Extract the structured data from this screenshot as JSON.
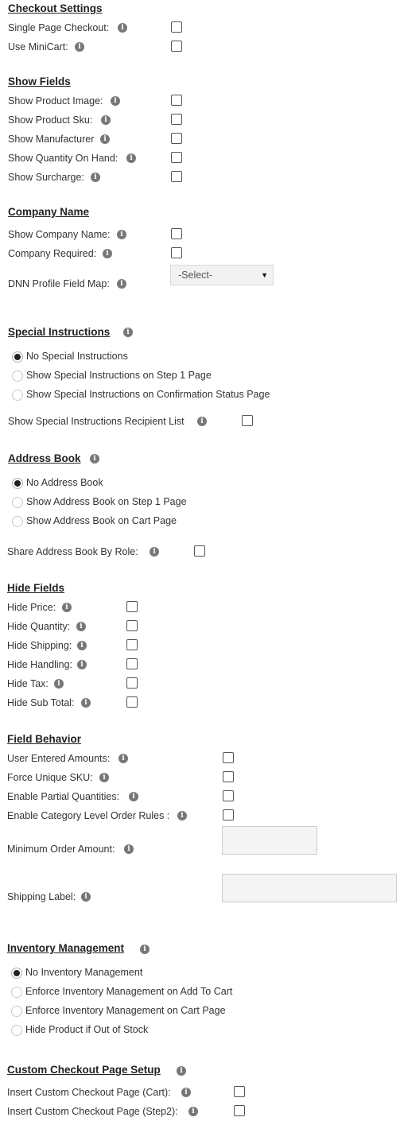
{
  "info_glyph": "i",
  "checkout": {
    "heading": "Checkout Settings",
    "single_page": "Single Page Checkout:",
    "use_minicart": "Use MiniCart:"
  },
  "show_fields": {
    "heading": "Show Fields",
    "product_image": "Show Product Image:",
    "product_sku": "Show Product Sku:",
    "manufacturer": "Show Manufacturer",
    "quantity_on_hand": "Show Quantity On Hand:",
    "surcharge": "Show Surcharge:"
  },
  "company": {
    "heading": "Company Name",
    "show_company": "Show Company Name:",
    "required": "Company Required:",
    "profile_map_label": "DNN Profile Field Map:",
    "profile_map_value": "-Select-"
  },
  "special_instructions": {
    "heading": "Special Instructions",
    "options": [
      "No Special Instructions",
      "Show Special Instructions on Step 1 Page",
      "Show Special Instructions on Confirmation Status Page"
    ],
    "selected_index": 0,
    "recipient_list": "Show Special Instructions Recipient List"
  },
  "address_book": {
    "heading": "Address Book",
    "options": [
      "No Address Book",
      "Show Address Book on Step 1 Page",
      "Show Address Book on Cart Page"
    ],
    "selected_index": 0,
    "share_by_role": "Share Address Book By Role:"
  },
  "hide_fields": {
    "heading": "Hide Fields",
    "price": "Hide Price:",
    "quantity": "Hide Quantity:",
    "shipping": "Hide Shipping:",
    "handling": "Hide Handling:",
    "tax": "Hide Tax:",
    "sub_total": "Hide Sub Total:"
  },
  "field_behavior": {
    "heading": "Field Behavior",
    "user_entered_amounts": "User Entered Amounts:",
    "force_unique_sku": "Force Unique SKU:",
    "partial_quantities": "Enable Partial Quantities:",
    "category_order_rules": "Enable Category Level Order Rules :",
    "minimum_order_amount": "Minimum Order Amount:",
    "minimum_order_value": "",
    "shipping_label": "Shipping Label:",
    "shipping_label_value": ""
  },
  "inventory": {
    "heading": "Inventory Management",
    "options": [
      "No Inventory Management",
      "Enforce Inventory Management on Add To Cart",
      "Enforce Inventory Management on Cart Page",
      "Hide Product if Out of Stock"
    ],
    "selected_index": 0
  },
  "custom_checkout": {
    "heading": "Custom Checkout Page Setup",
    "cart_page": "Insert Custom Checkout Page (Cart):",
    "step2_page": "Insert Custom Checkout Page (Step2):"
  }
}
